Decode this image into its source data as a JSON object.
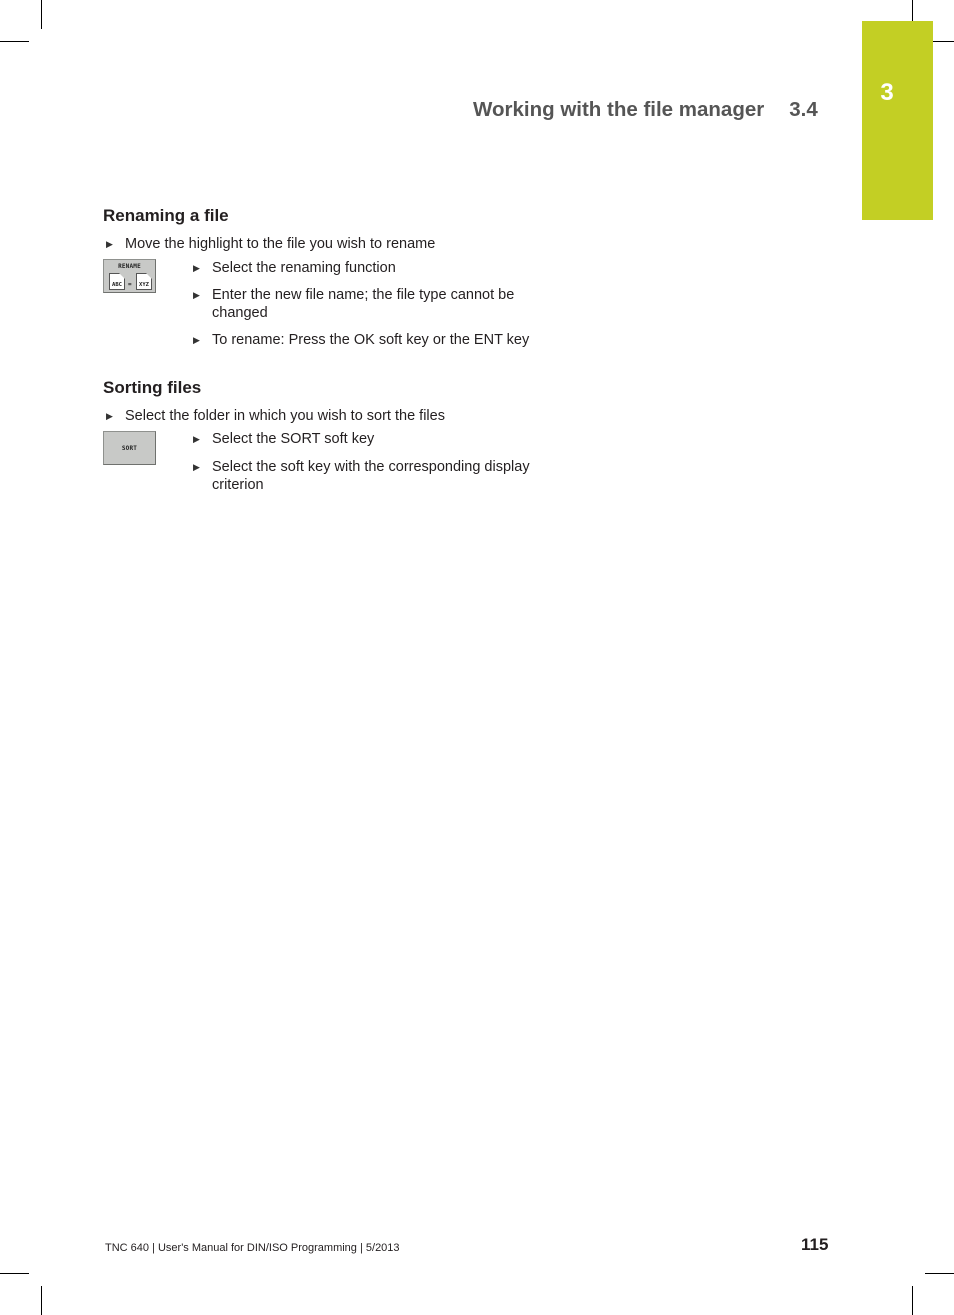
{
  "chapter_tab": {
    "number": "3",
    "color": "#c3cf24"
  },
  "running_head": {
    "title": "Working with the file manager",
    "section": "3.4"
  },
  "sections": [
    {
      "heading": "Renaming a file",
      "intro_bullet": "Move the highlight to the file you wish to rename",
      "softkey": {
        "icon": "rename-softkey-icon",
        "label": "RENAME",
        "from_file": "ABC",
        "separator": "=",
        "to_file": "XYZ"
      },
      "steps": [
        "Select the renaming function",
        "Enter the new file name; the file type cannot be changed",
        "To rename: Press the OK soft key or the ENT key"
      ]
    },
    {
      "heading": "Sorting files",
      "intro_bullet": "Select the folder in which you wish to sort the files",
      "softkey": {
        "icon": "sort-softkey-icon",
        "label": "SORT"
      },
      "steps": [
        "Select the SORT soft key",
        "Select the soft key with the corresponding display criterion"
      ]
    }
  ],
  "bullet_glyph": "▶",
  "footer": {
    "text": "TNC 640 | User's Manual for DIN/ISO Programming | 5/2013",
    "page_number": "115"
  }
}
